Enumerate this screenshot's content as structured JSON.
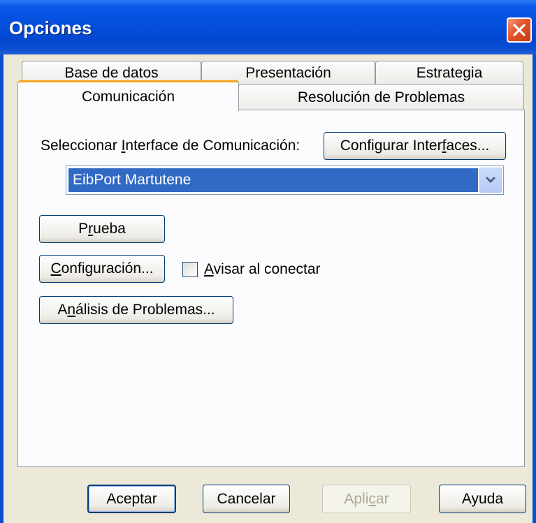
{
  "window": {
    "title": "Opciones"
  },
  "tabs": {
    "base_de_datos": "Base de datos",
    "presentacion": "Presentación",
    "estrategia": "Estrategia",
    "comunicacion": "Comunicación",
    "resolucion": "Resolución de Problemas",
    "active": "Comunicación"
  },
  "comm": {
    "interface_label_pre": "Seleccionar ",
    "interface_label_acc": "I",
    "interface_label_post": "nterface de Comunicación:",
    "configure_btn_pre": "Configurar Inter",
    "configure_btn_acc": "f",
    "configure_btn_post": "aces...",
    "selected_interface": "EibPort Martutene",
    "test_btn_pre": "P",
    "test_btn_acc": "r",
    "test_btn_post": "ueba",
    "config_btn_acc": "C",
    "config_btn_post": "onfiguración...",
    "warn_checkbox_acc": "A",
    "warn_checkbox_post": "visar al conectar",
    "warn_checked": false,
    "analysis_btn_pre": "A",
    "analysis_btn_acc": "n",
    "analysis_btn_post": "álisis de Problemas..."
  },
  "footer": {
    "accept": "Aceptar",
    "cancel": "Cancelar",
    "apply_pre": "Apli",
    "apply_acc": "c",
    "apply_post": "ar",
    "help": "Ayuda"
  },
  "icons": {
    "close": "close-icon",
    "dropdown": "chevron-down-icon"
  },
  "colors": {
    "titlebar": "#0550dd",
    "selection": "#316ac5",
    "close_button": "#e2552b",
    "active_tab_accent": "#f9a31f"
  }
}
